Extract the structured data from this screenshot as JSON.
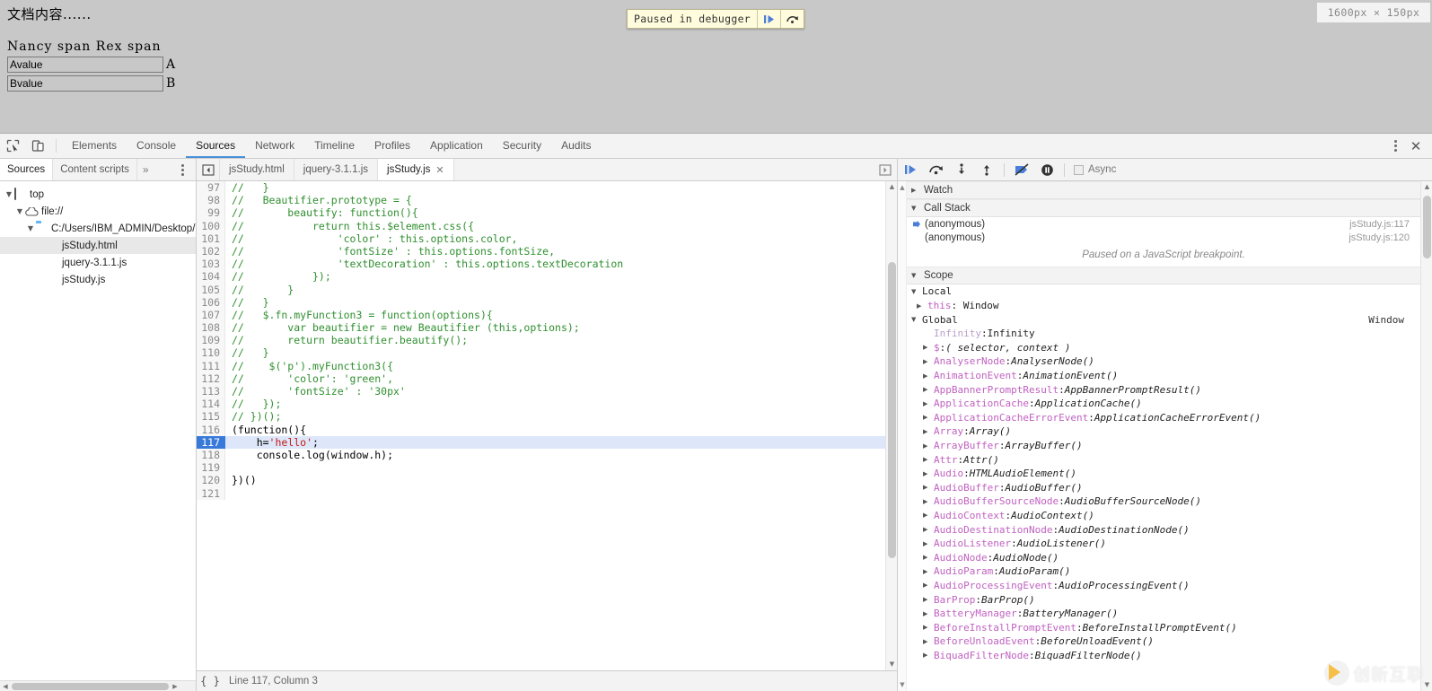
{
  "page": {
    "doc_title": "文档内容......",
    "span_line": "Nancy span Rex span",
    "fields": [
      {
        "value": "Avalue",
        "tag": "A"
      },
      {
        "value": "Bvalue",
        "tag": "B"
      }
    ],
    "size_indicator": "1600px × 150px",
    "paused_banner": {
      "text": "Paused in debugger",
      "resume_icon": "resume-icon",
      "step_over_icon": "step-over-icon"
    }
  },
  "devtools": {
    "tabs": [
      {
        "label": "Elements",
        "active": false
      },
      {
        "label": "Console",
        "active": false
      },
      {
        "label": "Sources",
        "active": true
      },
      {
        "label": "Network",
        "active": false
      },
      {
        "label": "Timeline",
        "active": false
      },
      {
        "label": "Profiles",
        "active": false
      },
      {
        "label": "Application",
        "active": false
      },
      {
        "label": "Security",
        "active": false
      },
      {
        "label": "Audits",
        "active": false
      }
    ],
    "inspect_icon": "inspect-element-icon",
    "device_icon": "device-toolbar-icon",
    "menu_icon": "more-options-icon",
    "close_icon": "close-icon"
  },
  "navigator": {
    "tabs": [
      {
        "label": "Sources",
        "active": true
      },
      {
        "label": "Content scripts",
        "active": false
      }
    ],
    "more_label": "»",
    "tree": [
      {
        "label": "top",
        "indent": 0,
        "twisty": "▼",
        "icon": "frame-icon",
        "selected": false
      },
      {
        "label": "file://",
        "indent": 1,
        "twisty": "▼",
        "icon": "cloud-icon",
        "selected": false
      },
      {
        "label": "C:/Users/IBM_ADMIN/Desktop/",
        "indent": 2,
        "twisty": "▼",
        "icon": "folder-icon",
        "selected": false
      },
      {
        "label": "jsStudy.html",
        "indent": 3,
        "twisty": "",
        "icon": "html-file-icon",
        "selected": true
      },
      {
        "label": "jquery-3.1.1.js",
        "indent": 3,
        "twisty": "",
        "icon": "js-file-icon",
        "selected": false
      },
      {
        "label": "jsStudy.js",
        "indent": 3,
        "twisty": "",
        "icon": "js-file-icon",
        "selected": false
      }
    ]
  },
  "editor": {
    "panel_toggle_icon": "show-navigator-icon",
    "file_tabs": [
      {
        "label": "jsStudy.html",
        "active": false,
        "closable": false
      },
      {
        "label": "jquery-3.1.1.js",
        "active": false,
        "closable": false
      },
      {
        "label": "jsStudy.js",
        "active": true,
        "closable": true,
        "close_label": "✕"
      }
    ],
    "right_toggle_icon": "show-debugger-icon",
    "pretty_print_label": "{ }",
    "status_text": "Line 117, Column 3",
    "highlight_line": 117,
    "lines": [
      {
        "n": 97,
        "text": "//   }",
        "comment": true
      },
      {
        "n": 98,
        "text": "//   Beautifier.prototype = {",
        "comment": true
      },
      {
        "n": 99,
        "text": "//       beautify: function(){",
        "comment": true
      },
      {
        "n": 100,
        "text": "//           return this.$element.css({",
        "comment": true
      },
      {
        "n": 101,
        "text": "//               'color' : this.options.color,",
        "comment": true
      },
      {
        "n": 102,
        "text": "//               'fontSize' : this.options.fontSize,",
        "comment": true
      },
      {
        "n": 103,
        "text": "//               'textDecoration' : this.options.textDecoration",
        "comment": true
      },
      {
        "n": 104,
        "text": "//           });",
        "comment": true
      },
      {
        "n": 105,
        "text": "//       }",
        "comment": true
      },
      {
        "n": 106,
        "text": "//   }",
        "comment": true
      },
      {
        "n": 107,
        "text": "//   $.fn.myFunction3 = function(options){",
        "comment": true
      },
      {
        "n": 108,
        "text": "//       var beautifier = new Beautifier (this,options);",
        "comment": true
      },
      {
        "n": 109,
        "text": "//       return beautifier.beautify();",
        "comment": true
      },
      {
        "n": 110,
        "text": "//   }",
        "comment": true
      },
      {
        "n": 111,
        "text": "//    $('p').myFunction3({",
        "comment": true
      },
      {
        "n": 112,
        "text": "//       'color': 'green',",
        "comment": true
      },
      {
        "n": 113,
        "text": "//       'fontSize' : '30px'",
        "comment": true
      },
      {
        "n": 114,
        "text": "//   });",
        "comment": true
      },
      {
        "n": 115,
        "text": "// })();",
        "comment": true
      },
      {
        "n": 116,
        "text": "(function(){",
        "comment": false
      },
      {
        "n": 117,
        "text": "    h='hello';",
        "comment": false,
        "highlight": true
      },
      {
        "n": 118,
        "text": "    console.log(window.h);",
        "comment": false
      },
      {
        "n": 119,
        "text": "",
        "comment": false
      },
      {
        "n": 120,
        "text": "})()",
        "comment": false
      },
      {
        "n": 121,
        "text": "",
        "comment": false
      }
    ]
  },
  "debugger": {
    "toolbar": {
      "resume_icon": "resume-script-icon",
      "step_over_icon": "step-over-icon",
      "step_into_icon": "step-into-icon",
      "step_out_icon": "step-out-icon",
      "deactivate_breakpoints_icon": "deactivate-breakpoints-icon",
      "pause_on_exceptions_icon": "pause-on-exceptions-icon",
      "async_label": "Async",
      "async_checked": false
    },
    "sections": {
      "watch": {
        "label": "Watch",
        "twisty": "▶",
        "expanded": false
      },
      "call_stack": {
        "label": "Call Stack",
        "twisty": "▼",
        "frames": [
          {
            "name": "(anonymous)",
            "location": "jsStudy.js:117",
            "active": true
          },
          {
            "name": "(anonymous)",
            "location": "jsStudy.js:120",
            "active": false
          }
        ],
        "note": "Paused on a JavaScript breakpoint."
      },
      "scope": {
        "label": "Scope",
        "twisty": "▼",
        "local": {
          "label": "Local",
          "twisty": "▼",
          "items": [
            {
              "key": "this",
              "value": "Window",
              "twisty": "▶",
              "italic": false
            }
          ]
        },
        "global": {
          "label": "Global",
          "twisty": "▼",
          "right_label": "Window",
          "items": [
            {
              "key": "Infinity",
              "value": "Infinity",
              "twisty": "",
              "dim": true,
              "italic": false
            },
            {
              "key": "$",
              "value": "( selector, context )",
              "twisty": "▶",
              "italic": true
            },
            {
              "key": "AnalyserNode",
              "value": "AnalyserNode()",
              "twisty": "▶",
              "italic": true
            },
            {
              "key": "AnimationEvent",
              "value": "AnimationEvent()",
              "twisty": "▶",
              "italic": true
            },
            {
              "key": "AppBannerPromptResult",
              "value": "AppBannerPromptResult()",
              "twisty": "▶",
              "italic": true
            },
            {
              "key": "ApplicationCache",
              "value": "ApplicationCache()",
              "twisty": "▶",
              "italic": true
            },
            {
              "key": "ApplicationCacheErrorEvent",
              "value": "ApplicationCacheErrorEvent()",
              "twisty": "▶",
              "italic": true
            },
            {
              "key": "Array",
              "value": "Array()",
              "twisty": "▶",
              "italic": true
            },
            {
              "key": "ArrayBuffer",
              "value": "ArrayBuffer()",
              "twisty": "▶",
              "italic": true
            },
            {
              "key": "Attr",
              "value": "Attr()",
              "twisty": "▶",
              "italic": true
            },
            {
              "key": "Audio",
              "value": "HTMLAudioElement()",
              "twisty": "▶",
              "italic": true
            },
            {
              "key": "AudioBuffer",
              "value": "AudioBuffer()",
              "twisty": "▶",
              "italic": true
            },
            {
              "key": "AudioBufferSourceNode",
              "value": "AudioBufferSourceNode()",
              "twisty": "▶",
              "italic": true
            },
            {
              "key": "AudioContext",
              "value": "AudioContext()",
              "twisty": "▶",
              "italic": true
            },
            {
              "key": "AudioDestinationNode",
              "value": "AudioDestinationNode()",
              "twisty": "▶",
              "italic": true
            },
            {
              "key": "AudioListener",
              "value": "AudioListener()",
              "twisty": "▶",
              "italic": true
            },
            {
              "key": "AudioNode",
              "value": "AudioNode()",
              "twisty": "▶",
              "italic": true
            },
            {
              "key": "AudioParam",
              "value": "AudioParam()",
              "twisty": "▶",
              "italic": true
            },
            {
              "key": "AudioProcessingEvent",
              "value": "AudioProcessingEvent()",
              "twisty": "▶",
              "italic": true
            },
            {
              "key": "BarProp",
              "value": "BarProp()",
              "twisty": "▶",
              "italic": true
            },
            {
              "key": "BatteryManager",
              "value": "BatteryManager()",
              "twisty": "▶",
              "italic": true
            },
            {
              "key": "BeforeInstallPromptEvent",
              "value": "BeforeInstallPromptEvent()",
              "twisty": "▶",
              "italic": true
            },
            {
              "key": "BeforeUnloadEvent",
              "value": "BeforeUnloadEvent()",
              "twisty": "▶",
              "italic": true
            },
            {
              "key": "BiquadFilterNode",
              "value": "BiquadFilterNode()",
              "twisty": "▶",
              "italic": true
            }
          ]
        }
      }
    }
  },
  "watermark": {
    "text": "创新互联"
  }
}
